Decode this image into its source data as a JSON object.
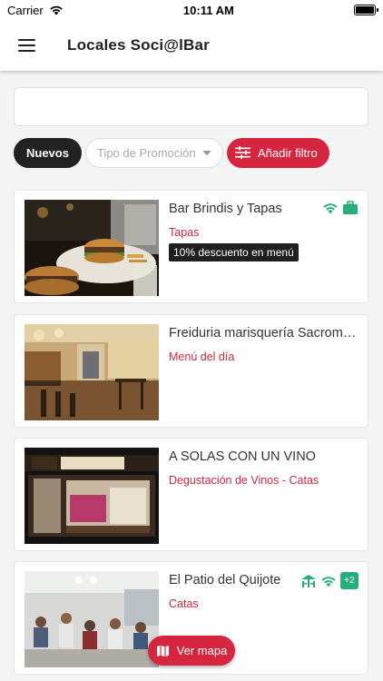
{
  "status_bar": {
    "carrier": "Carrier",
    "time": "10:11 AM",
    "battery_level": 1.0
  },
  "header": {
    "title": "Locales Soci@lBar",
    "menu_icon": "hamburger-icon"
  },
  "search": {
    "value": "",
    "placeholder": ""
  },
  "filters": {
    "nuevos_label": "Nuevos",
    "promo_placeholder": "Tipo de Promoción",
    "add_filter_label": "Añadir filtro"
  },
  "venues": [
    {
      "name": "Bar Brindis y Tapas",
      "category": "Tapas",
      "promotion": "10% descuento en menú",
      "icons": [
        "wifi-icon",
        "briefcase-icon"
      ]
    },
    {
      "name": "Freiduria marisquería Sacromonte",
      "category": "Menú del día",
      "promotion": "",
      "icons": []
    },
    {
      "name": "A SOLAS CON UN VINO",
      "category": "Degustación de Vinos - Catas",
      "promotion": "",
      "icons": []
    },
    {
      "name": "El Patio del Quijote",
      "category": "Catas",
      "promotion": "",
      "icons": [
        "terrace-icon",
        "wifi-icon"
      ],
      "more_count": "+2"
    }
  ],
  "map_button": {
    "label": "Ver mapa",
    "icon": "map-icon"
  },
  "colors": {
    "accent": "#d6263f",
    "feature_icon": "#27ad78",
    "category_text": "#c8273e",
    "dark_chip": "#222222"
  }
}
